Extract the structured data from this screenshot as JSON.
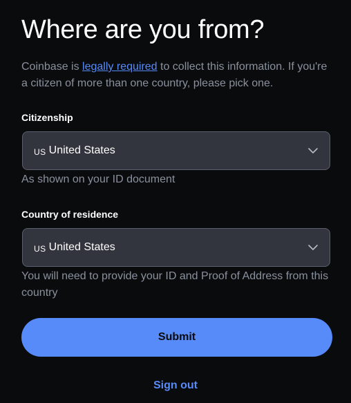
{
  "title": "Where are you from?",
  "intro": {
    "before": "Coinbase is ",
    "link": "legally required",
    "after": " to collect this information. If you're a citizen of more than one country, please pick one."
  },
  "citizenship": {
    "label": "Citizenship",
    "country_code": "US",
    "value": "United States",
    "hint": "As shown on your ID document"
  },
  "residence": {
    "label": "Country of residence",
    "country_code": "US",
    "value": "United States",
    "hint": "You will need to provide your ID and Proof of Address from this country"
  },
  "submit_label": "Submit",
  "signout_label": "Sign out",
  "colors": {
    "background": "#0a0b0d",
    "accent": "#578bfa",
    "field_bg": "#32353d",
    "muted_text": "#8a919e"
  },
  "icons": {
    "dropdown": "chevron-down-icon"
  }
}
